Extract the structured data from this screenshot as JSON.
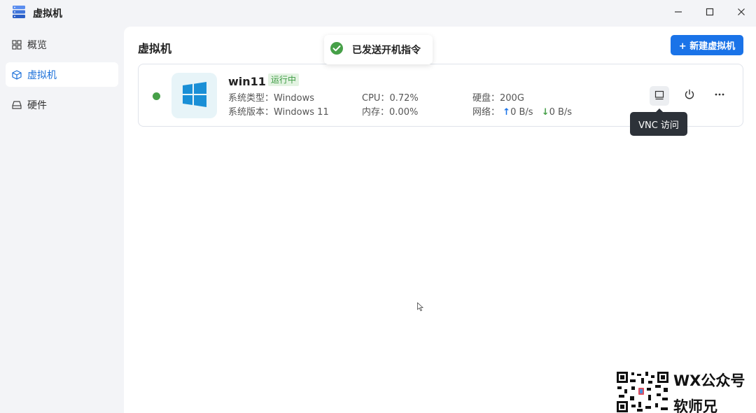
{
  "window": {
    "title": "虚拟机",
    "icon": "server-stack-icon",
    "controls": [
      "minimize-icon",
      "maximize-icon",
      "close-icon"
    ]
  },
  "sidebar": {
    "items": [
      {
        "label": "概览",
        "icon": "grid-icon",
        "active": false
      },
      {
        "label": "虚拟机",
        "icon": "cube-icon",
        "active": true
      },
      {
        "label": "硬件",
        "icon": "drive-icon",
        "active": false
      }
    ]
  },
  "main": {
    "title": "虚拟机",
    "new_vm_label": "+ 新建虚拟机"
  },
  "toast": {
    "text": "已发送开机指令",
    "icon": "check-circle-icon",
    "color": "#46a048"
  },
  "vm": {
    "name": "win11",
    "status": "运行中",
    "status_color": "#46a048",
    "os_icon": "windows-logo-icon",
    "os_type_label": "系统类型：",
    "os_type": "Windows",
    "os_version_label": "系统版本：",
    "os_version": "Windows 11",
    "cpu_label": "CPU：",
    "cpu": "0.72%",
    "memory_label": "内存：",
    "memory": "0.00%",
    "disk_label": "硬盘：",
    "disk": "200G",
    "network_label": "网络：",
    "net_up": "0 B/s",
    "net_down": "0 B/s",
    "actions": [
      "monitor-icon",
      "power-icon",
      "more-horizontal-icon"
    ]
  },
  "tooltip": {
    "text": "VNC 访问"
  },
  "watermark": {
    "line1": "WX公众号",
    "line2": "软师兄"
  },
  "colors": {
    "accent": "#1a73e8",
    "background": "#f3f4f7"
  }
}
